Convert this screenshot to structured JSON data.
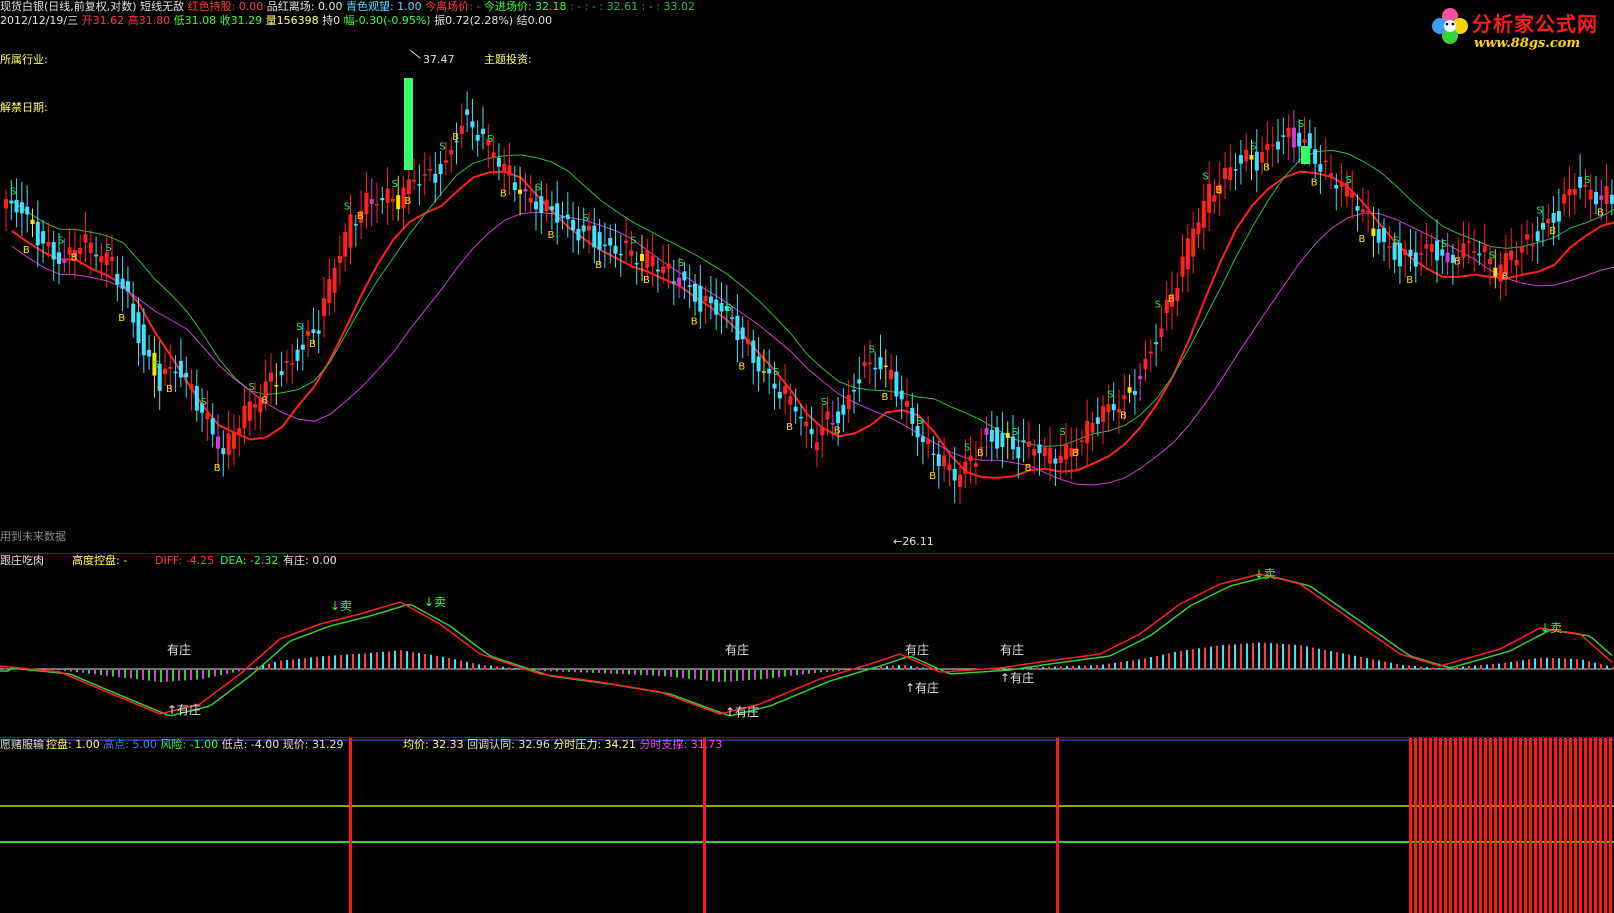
{
  "colors": {
    "background": "#000000",
    "up_candle": "#ff2020",
    "down_candle": "#40e0ff",
    "signal_buy": "#ffe000",
    "signal_sell": "#00ff60",
    "ma_short": "#ff2020",
    "ma_mid": "#2bbf3a",
    "ma_long": "#d33ad3",
    "label_yellow": "#ffff66",
    "label_green": "#33ff33",
    "label_red": "#ff3b3b",
    "label_white": "#e0e0e0"
  },
  "header": {
    "line1": [
      {
        "text": "现货白银(日线,前复权,对数)",
        "color": "#e0e0e0"
      },
      {
        "text": " 短线无敌 ",
        "color": "#e0e0e0"
      },
      {
        "text": "红色持股: 0.00",
        "color": "#ff3b3b"
      },
      {
        "text": "  品红离场: 0.00",
        "color": "#e0e0e0"
      },
      {
        "text": "  青色观望: 1.00",
        "color": "#40e0ff"
      },
      {
        "text": "  今离场价: -",
        "color": "#ff3b3b"
      },
      {
        "text": "  今进场价: 32.18",
        "color": "#33ff33"
      },
      {
        "text": " : -   : -   : 32.61   : -   : 33.02",
        "color": "#2bbf3a"
      }
    ],
    "line2": [
      {
        "text": "2012/12/19/三",
        "color": "#e0e0e0"
      },
      {
        "text": " 开31.62",
        "color": "#ff3b3b"
      },
      {
        "text": " 高31.80",
        "color": "#ff3b3b"
      },
      {
        "text": " 低31.08",
        "color": "#33ff33"
      },
      {
        "text": " 收31.29",
        "color": "#33ff33"
      },
      {
        "text": " 量156398",
        "color": "#ffff66"
      },
      {
        "text": " 持0",
        "color": "#e0e0e0"
      },
      {
        "text": " 幅-0.30(-0.95%)",
        "color": "#33ff33"
      },
      {
        "text": " 振0.72(2.28%)",
        "color": "#e0e0e0"
      },
      {
        "text": " 结0.00",
        "color": "#e0e0e0"
      }
    ]
  },
  "main_panel": {
    "industry_label": "所属行业:",
    "theme_label": "主题投资:",
    "unlock_label": "解禁日期:",
    "high_marker": "37.47",
    "low_marker": "←26.11",
    "future_data_note": "用到未来数据",
    "buy_glyph": "B",
    "sell_glyph": "S"
  },
  "mid_panel": {
    "title": "跟庄吃肉",
    "control_label": "高度控盘: -",
    "diff": "DIFF: -4.25",
    "dea": "DEA: -2.32",
    "youzhuang": "有庄: 0.00",
    "annotations": [
      "有庄",
      "↑有庄",
      "↓卖"
    ]
  },
  "bottom_panel": {
    "title": "愿赌服输",
    "items": [
      {
        "text": "控盘: 1.00",
        "color": "#ffff66"
      },
      {
        "text": "高点: 5.00",
        "color": "#4a78ff"
      },
      {
        "text": "风险: -1.00",
        "color": "#33ff33"
      },
      {
        "text": "低点: -4.00",
        "color": "#e0e0e0"
      },
      {
        "text": "现价: 31.29",
        "color": "#e0e0e0"
      },
      {
        "text": "均价: 32.33",
        "color": "#ffff66"
      },
      {
        "text": "回调认同: 32.96",
        "color": "#e0e0e0"
      },
      {
        "text": "分时压力: 34.21",
        "color": "#ffff66"
      },
      {
        "text": "分时支撑: 31.73",
        "color": "#ff40ff"
      }
    ]
  },
  "logo": {
    "title": "分析家公式网",
    "url": "www.88gs.com"
  },
  "chart_data": {
    "type": "candlestick",
    "title": "现货白银(日线,前复权,对数)",
    "price_range_visible": [
      26.11,
      37.47
    ],
    "closes": [
      34.2,
      33.6,
      33.1,
      32.9,
      33.4,
      33.0,
      32.7,
      31.8,
      30.4,
      29.6,
      29.9,
      29.3,
      28.6,
      27.8,
      28.6,
      29.0,
      29.6,
      30.0,
      30.6,
      31.1,
      32.6,
      33.8,
      34.5,
      34.6,
      34.4,
      34.9,
      35.0,
      35.4,
      36.6,
      36.2,
      35.6,
      35.1,
      34.6,
      34.3,
      34.0,
      33.5,
      33.5,
      33.2,
      33.2,
      32.9,
      32.8,
      32.5,
      32.3,
      31.7,
      31.5,
      31.1,
      30.5,
      29.9,
      29.4,
      28.9,
      28.0,
      28.6,
      28.8,
      29.8,
      30.0,
      29.7,
      28.9,
      28.1,
      27.6,
      27.0,
      27.4,
      28.2,
      28.0,
      27.8,
      27.8,
      27.6,
      27.8,
      28.2,
      28.7,
      28.8,
      29.2,
      30.1,
      31.2,
      32.3,
      33.6,
      34.6,
      35.2,
      35.6,
      35.4,
      35.8,
      36.1,
      36.0,
      35.4,
      34.9,
      34.5,
      33.9,
      33.3,
      32.9,
      32.8,
      33.1,
      32.8,
      33.3,
      33.2,
      32.5,
      32.9,
      33.3,
      33.7,
      34.1,
      34.8,
      34.5,
      34.6,
      34.3,
      33.6
    ]
  }
}
